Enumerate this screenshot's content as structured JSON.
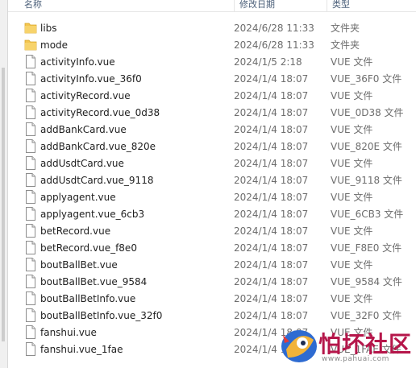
{
  "columns": {
    "name": "名称",
    "date": "修改日期",
    "type": "类型"
  },
  "files": [
    {
      "name": "libs",
      "date": "2024/6/28 11:33",
      "type": "文件夹",
      "icon": "folder-icon"
    },
    {
      "name": "mode",
      "date": "2024/6/28 11:33",
      "type": "文件夹",
      "icon": "folder-icon"
    },
    {
      "name": "activityInfo.vue",
      "date": "2024/1/5 2:18",
      "type": "VUE 文件",
      "icon": "file-icon"
    },
    {
      "name": "activityInfo.vue_36f0",
      "date": "2024/1/4 18:07",
      "type": "VUE_36F0 文件",
      "icon": "file-icon"
    },
    {
      "name": "activityRecord.vue",
      "date": "2024/1/4 18:07",
      "type": "VUE 文件",
      "icon": "file-icon"
    },
    {
      "name": "activityRecord.vue_0d38",
      "date": "2024/1/4 18:07",
      "type": "VUE_0D38 文件",
      "icon": "file-icon"
    },
    {
      "name": "addBankCard.vue",
      "date": "2024/1/4 18:07",
      "type": "VUE 文件",
      "icon": "file-icon"
    },
    {
      "name": "addBankCard.vue_820e",
      "date": "2024/1/4 18:07",
      "type": "VUE_820E 文件",
      "icon": "file-icon"
    },
    {
      "name": "addUsdtCard.vue",
      "date": "2024/1/4 18:07",
      "type": "VUE 文件",
      "icon": "file-icon"
    },
    {
      "name": "addUsdtCard.vue_9118",
      "date": "2024/1/4 18:07",
      "type": "VUE_9118 文件",
      "icon": "file-icon"
    },
    {
      "name": "applyagent.vue",
      "date": "2024/1/4 18:07",
      "type": "VUE 文件",
      "icon": "file-icon"
    },
    {
      "name": "applyagent.vue_6cb3",
      "date": "2024/1/4 18:07",
      "type": "VUE_6CB3 文件",
      "icon": "file-icon"
    },
    {
      "name": "betRecord.vue",
      "date": "2024/1/4 18:07",
      "type": "VUE 文件",
      "icon": "file-icon"
    },
    {
      "name": "betRecord.vue_f8e0",
      "date": "2024/1/4 18:07",
      "type": "VUE_F8E0 文件",
      "icon": "file-icon"
    },
    {
      "name": "boutBallBet.vue",
      "date": "2024/1/4 18:07",
      "type": "VUE 文件",
      "icon": "file-icon"
    },
    {
      "name": "boutBallBet.vue_9584",
      "date": "2024/1/4 18:07",
      "type": "VUE_9584 文件",
      "icon": "file-icon"
    },
    {
      "name": "boutBallBetInfo.vue",
      "date": "2024/1/4 18:07",
      "type": "VUE 文件",
      "icon": "file-icon"
    },
    {
      "name": "boutBallBetInfo.vue_32f0",
      "date": "2024/1/4 18:07",
      "type": "VUE_32F0 文件",
      "icon": "file-icon"
    },
    {
      "name": "fanshui.vue",
      "date": "2024/1/4 18:07",
      "type": "VUE 文件",
      "icon": "file-icon"
    },
    {
      "name": "fanshui.vue_1fae",
      "date": "2024/1/4 18:07",
      "type": "VUE_1FAE 文件",
      "icon": "file-icon"
    }
  ],
  "watermark": {
    "text": "怕坏社区",
    "url": "www.pahuai.com"
  },
  "colors": {
    "folder": "#f3c54e",
    "header_text": "#4c607a",
    "meta_text": "#6d6d6d",
    "watermark": "#b5164a"
  }
}
